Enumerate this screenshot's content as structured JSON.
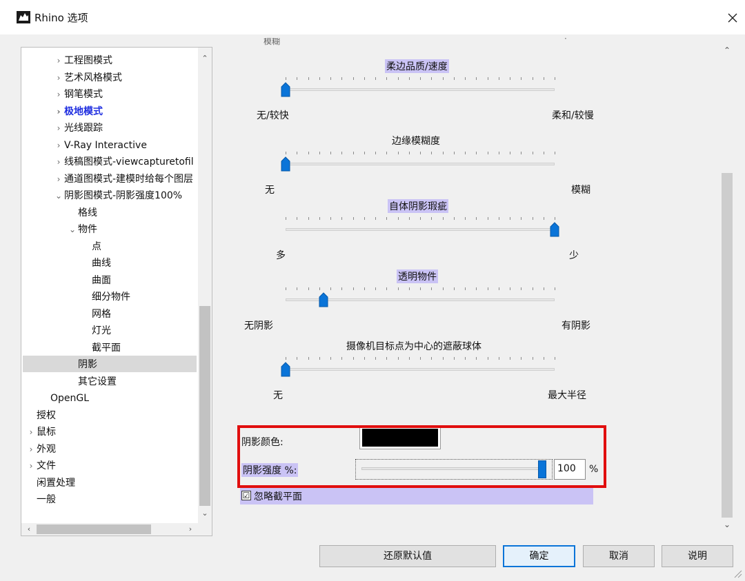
{
  "window": {
    "title": "Rhino 选项",
    "close_glyph": "✕",
    "app_icon": "rhino-logo-icon",
    "close_icon": "close-icon"
  },
  "tree": {
    "items": [
      {
        "label": "工程图模式",
        "expander": "›"
      },
      {
        "label": "艺术风格模式",
        "expander": "›"
      },
      {
        "label": "钢笔模式",
        "expander": "›"
      },
      {
        "label": "极地模式",
        "expander": "›"
      },
      {
        "label": "光线跟踪",
        "expander": "›"
      },
      {
        "label": "V-Ray Interactive",
        "expander": "›"
      },
      {
        "label": "线稿图模式-viewcapturetofil",
        "expander": "›"
      },
      {
        "label": "通道图模式-建模时给每个图层",
        "expander": "›"
      },
      {
        "label": "阴影图模式-阴影强度100%",
        "expander": "⌄"
      },
      {
        "label": "格线",
        "expander": ""
      },
      {
        "label": "物件",
        "expander": "⌄"
      },
      {
        "label": "点",
        "expander": ""
      },
      {
        "label": "曲线",
        "expander": ""
      },
      {
        "label": "曲面",
        "expander": ""
      },
      {
        "label": "细分物件",
        "expander": ""
      },
      {
        "label": "网格",
        "expander": ""
      },
      {
        "label": "灯光",
        "expander": ""
      },
      {
        "label": "截平面",
        "expander": ""
      },
      {
        "label": "阴影",
        "expander": ""
      },
      {
        "label": "其它设置",
        "expander": ""
      },
      {
        "label": "OpenGL",
        "expander": ""
      },
      {
        "label": "授权",
        "expander": ""
      },
      {
        "label": "鼠标",
        "expander": "›"
      },
      {
        "label": "外观",
        "expander": "›"
      },
      {
        "label": "文件",
        "expander": "›"
      },
      {
        "label": "闲置处理",
        "expander": ""
      },
      {
        "label": "一般",
        "expander": ""
      }
    ],
    "selected_index": 18,
    "highlighted_index": 3,
    "scroll_up": "⌃",
    "scroll_down": "⌄",
    "scroll_left": "‹",
    "scroll_right": "›"
  },
  "settings": {
    "cut_off_left": "模糊",
    "cut_off_right": "·",
    "sliders": [
      {
        "title": "柔边品质/速度",
        "left": "无/较快",
        "right": "柔和/较慢",
        "value": 0.0
      },
      {
        "title": "边缘模糊度",
        "left": "无",
        "right": "模糊",
        "value": 0.0
      },
      {
        "title": "自体阴影瑕疵",
        "left": "多",
        "right": "少",
        "value": 1.0
      },
      {
        "title": "透明物件",
        "left": "无阴影",
        "right": "有阴影",
        "value": 0.14
      },
      {
        "title": "摄像机目标点为中心的遮蔽球体",
        "left": "无",
        "right": "最大半径",
        "value": 0.0
      }
    ],
    "shadow_color_label": "阴影颜色:",
    "shadow_color": "#000000",
    "shadow_strength_label": "阴影强度 %:",
    "shadow_strength_value": "100",
    "shadow_strength_fraction": 1.0,
    "percent_sign": "%",
    "ignore_clip_label": "忽略截平面",
    "ignore_clip_checked": "☑",
    "scroll_up": "⌃",
    "scroll_down": "⌄"
  },
  "buttons": {
    "restore": "还原默认值",
    "ok": "确定",
    "cancel": "取消",
    "help": "说明"
  },
  "colors": {
    "highlight": "#cac3f5",
    "accent": "#0a74d8",
    "annotation_red": "#e10e0e",
    "tree_active": "#1f2ee0"
  }
}
